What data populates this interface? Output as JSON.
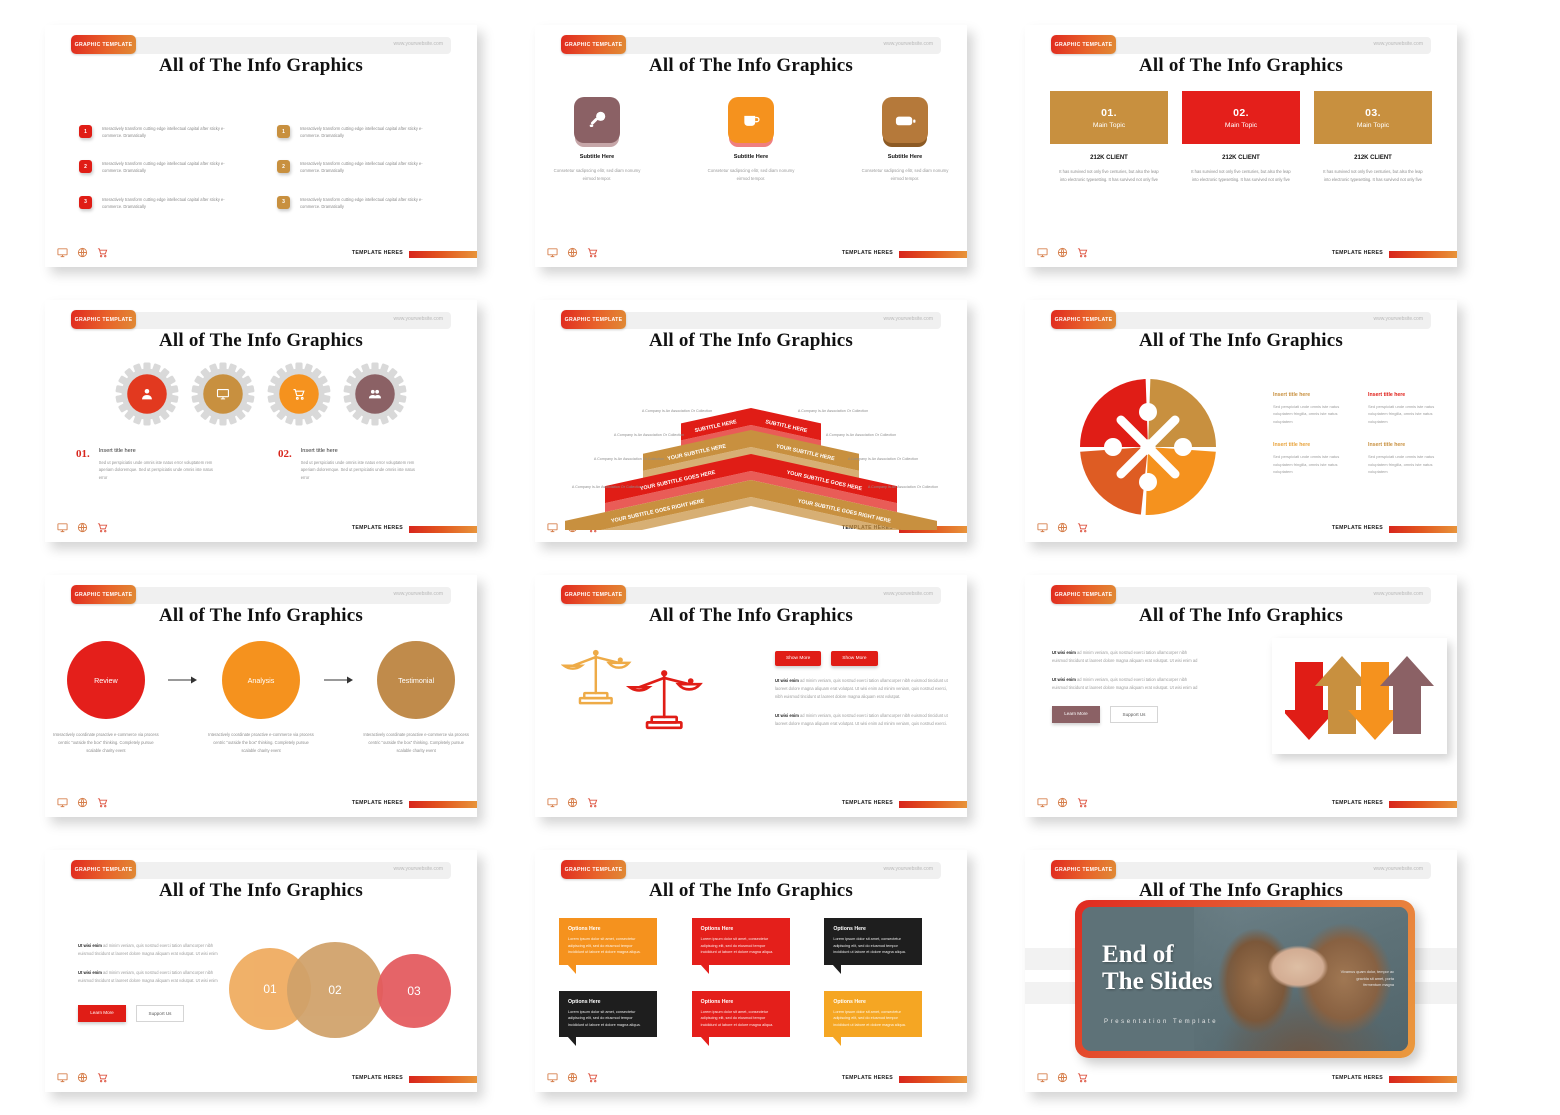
{
  "common": {
    "badge": "GRAPHIC TEMPLATE",
    "website": "www.yourwebsite.com",
    "title": "All of The Info Graphics",
    "footer_label": "TEMPLATE HERES"
  },
  "colors": {
    "red": "#e01d16",
    "orange": "#f5921e",
    "tan": "#c8903f",
    "mauve": "#8b6165",
    "brown": "#b5793a",
    "dark": "#1e1e1e",
    "peach": "#efab5e",
    "pink": "#e4595d",
    "camel": "#d0a169"
  },
  "slides": [
    {
      "id": "slide-list",
      "items_left": [
        {
          "num": "1",
          "text": "Interactively transform cutting edge intellectual capital after sticky e-commerce. Dramatically"
        },
        {
          "num": "2",
          "text": "Interactively transform cutting edge intellectual capital after sticky e-commerce. Dramatically"
        },
        {
          "num": "3",
          "text": "Interactively transform cutting edge intellectual capital after sticky e-commerce. Dramatically"
        }
      ],
      "items_right": [
        {
          "num": "1",
          "text": "Interactively transform cutting edge intellectual capital after sticky e-commerce. Dramatically"
        },
        {
          "num": "2",
          "text": "Interactively transform cutting edge intellectual capital after sticky e-commerce. Dramatically"
        },
        {
          "num": "3",
          "text": "Interactively transform cutting edge intellectual capital after sticky e-commerce. Dramatically"
        }
      ]
    },
    {
      "id": "slide-icon-cards",
      "cards": [
        {
          "icon": "key-icon",
          "color": "#8b6165",
          "shadow": "#c6a6a8",
          "subtitle": "Subtitle Here",
          "body": "Consetetur sadipscing elitr, sed diam nonumy eirmod tempor."
        },
        {
          "icon": "coffee-cup-icon",
          "color": "#f5921e",
          "shadow": "#ef7f7f",
          "subtitle": "Subtitle Here",
          "body": "Consetetur sadipscing elitr, sed diam nonumy eirmod tempor."
        },
        {
          "icon": "battery-icon",
          "color": "#b5793a",
          "shadow": "#8c5a24",
          "subtitle": "Subtitle Here",
          "body": "Consetetur sadipscing elitr, sed diam nonumy eirmod tempor."
        }
      ]
    },
    {
      "id": "slide-main-topics",
      "topics": [
        {
          "num": "01.",
          "label": "Main Topic",
          "color": "#c8903f",
          "client": "212K CLIENT",
          "body": "It has survived not only five centuries, but also the leap into electronic typesetting. It has survived not only five"
        },
        {
          "num": "02.",
          "label": "Main Topic",
          "color": "#e41f1b",
          "client": "212K CLIENT",
          "body": "It has survived not only five centuries, but also the leap into electronic typesetting. It has survived not only five"
        },
        {
          "num": "03.",
          "label": "Main Topic",
          "color": "#c8903f",
          "client": "212K CLIENT",
          "body": "It has survived not only five centuries, but also the leap into electronic typesetting. It has survived not only five"
        }
      ]
    },
    {
      "id": "slide-gears",
      "gears": [
        {
          "icon": "user-icon",
          "color": "#e2391f"
        },
        {
          "icon": "monitor-icon",
          "color": "#c8903f"
        },
        {
          "icon": "cart-icon",
          "color": "#f5921e"
        },
        {
          "icon": "group-icon",
          "color": "#8b6165"
        }
      ],
      "items": [
        {
          "num": "01.",
          "heading": "Insert title here",
          "body": "Sed ut perspiciatis unde omnis iste natus error voluptatem rem aperiam doloremque. Sed ut perspiciatis unde omnis iste natus error"
        },
        {
          "num": "02.",
          "heading": "Insert title here",
          "body": "Sed ut perspiciatis unde omnis iste natus error voluptatem rem aperiam doloremque. Sed ut perspiciatis unde omnis iste natus error"
        }
      ]
    },
    {
      "id": "slide-pyramid",
      "bands": [
        {
          "text": "SUBTITLE HERE",
          "color": "#e01d16"
        },
        {
          "text": "SUBTITLE HERE",
          "color": "#e01d16"
        },
        {
          "text": "YOUR SUBTITLE HERE",
          "color": "#c8903f"
        },
        {
          "text": "YOUR SUBTITLE HERE",
          "color": "#c8903f"
        },
        {
          "text": "YOUR SUBTITLE GOES HERE",
          "color": "#e01d16"
        },
        {
          "text": "YOUR SUBTITLE GOES HERE",
          "color": "#e01d16"
        },
        {
          "text": "YOUR SUBTITLE GOES RIGHT HERE",
          "color": "#c8903f"
        },
        {
          "text": "YOUR SUBTITLE GOES RIGHT HERE",
          "color": "#c8903f"
        }
      ],
      "side_labels": [
        "A Company Is An Association Or Collection",
        "A Company Is An Association Or Collection",
        "A Company Is An Association Or Collection",
        "A Company Is An Association Or Collection",
        "A Company Is An Association Or Collection",
        "A Company Is An Association Or Collection",
        "A Company Is An Association Or Collection",
        "A Company Is An Association Or Collection"
      ]
    },
    {
      "id": "slide-puzzle",
      "pieces": [
        "#e01d16",
        "#c8903f",
        "#f5921e",
        "#de5c23"
      ],
      "items": [
        {
          "heading": "Insert title here",
          "color": "#c8903f",
          "body": "Sed perspiciati unde omnis iste natus voluptatem fringilla, omnis iste natus voluptatem"
        },
        {
          "heading": "Insert title here",
          "color": "#e01d16",
          "body": "Sed perspiciati unde omnis iste natus voluptatem fringilla, omnis iste natus voluptatem"
        },
        {
          "heading": "Insert title here",
          "color": "#e8a33c",
          "body": "Sed perspiciati unde omnis iste natus voluptatem fringilla, omnis iste natus voluptatem"
        },
        {
          "heading": "Insert title here",
          "color": "#c8903f",
          "body": "Sed perspiciati unde omnis iste natus voluptatem fringilla, omnis iste natus voluptatem"
        }
      ]
    },
    {
      "id": "slide-process",
      "steps": [
        {
          "label": "Review",
          "color": "#e41f1b",
          "body": "Interactively coordinate proactive e-commerce via process centric \"outside the box\" thinking. Completely pursue scalable charity event"
        },
        {
          "label": "Analysis",
          "color": "#f5921e",
          "body": "Interactively coordinate proactive e-commerce via process centric \"outside the box\" thinking. Completely pursue scalable charity event"
        },
        {
          "label": "Testimonial",
          "color": "#c08b4b",
          "body": "Interactively coordinate proactive e-commerce via process centric \"outside the box\" thinking. Completely pursue scalable charity event"
        }
      ]
    },
    {
      "id": "slide-scales",
      "buttons": [
        "Show More",
        "Show More"
      ],
      "paragraphs": [
        {
          "lead": "Ut wisi enim",
          "rest": " ad minim veniam, quis nostrud exerci tation ullamcorper nibh euismod tincidunt ut laoreet dolore magna aliquam erat volutpat. Ut wisi enim ad minim veniam, quis nostrud exerci, nibh euismod tincidunt ut laoreet dolore magna aliquam erat volutpat."
        },
        {
          "lead": "Ut wisi enim",
          "rest": " ad minim veniam, quis nostrud exerci tation ullamcorper nibh euismod tincidunt ut laoreet dolore magna aliquam erat volutpat. Ut wisi enim ad minim veniam, quis nostrud exerci."
        }
      ]
    },
    {
      "id": "slide-arrows",
      "paragraphs": [
        {
          "lead": "Ut wisi enim",
          "rest": " ad minim veniam, quis nostrud exerci tation ullamcorper nibh euismod tincidunt ut laoreet dolore magna aliquam erat volutpat. Ut wisi enim ad"
        },
        {
          "lead": "Ut wisi enim",
          "rest": " ad minim veniam, quis nostrud exerci tation ullamcorper nibh euismod tincidunt ut laoreet dolore magna aliquam erat volutpat. Ut wisi enim ad"
        }
      ],
      "buttons": [
        "Learn More",
        "Support Us"
      ],
      "arrows": [
        {
          "dir": "down",
          "color": "#e01d16"
        },
        {
          "dir": "up",
          "color": "#c8903f"
        },
        {
          "dir": "down",
          "color": "#f5921e"
        },
        {
          "dir": "up",
          "color": "#8b6165"
        }
      ]
    },
    {
      "id": "slide-circles",
      "paragraphs": [
        {
          "lead": "Ut wisi enim",
          "rest": " ad minim veniam, quis nostrud exerci tation ullamcorper nibh euismod tincidunt ut laoreet dolore magna aliquam erat volutpat. Ut wisi enim"
        },
        {
          "lead": "Ut wisi enim",
          "rest": " ad minim veniam, quis nostrud exerci tation ullamcorper nibh euismod tincidunt ut laoreet dolore magna aliquam erat volutpat. Ut wisi enim"
        }
      ],
      "buttons": [
        "Learn More",
        "Support Us"
      ],
      "circles": [
        {
          "num": "01",
          "color": "#efab5e"
        },
        {
          "num": "02",
          "color": "#d0a169"
        },
        {
          "num": "03",
          "color": "#e4595d"
        }
      ]
    },
    {
      "id": "slide-bubbles",
      "bubbles": [
        {
          "heading": "Options Here",
          "color": "#f5921e",
          "body": "Lorem ipsum dolor sit amet, consectetur adipiscing elit, sed do eiusmod tempor incididunt ut labore et dolore magna aliqua."
        },
        {
          "heading": "Options Here",
          "color": "#e41f1b",
          "body": "Lorem ipsum dolor sit amet, consectetur adipiscing elit, sed do eiusmod tempor incididunt ut labore et dolore magna aliqua."
        },
        {
          "heading": "Options Here",
          "color": "#1e1e1e",
          "body": "Lorem ipsum dolor sit amet, consectetur adipiscing elit, sed do eiusmod tempor incididunt ut labore et dolore magna aliqua."
        },
        {
          "heading": "Options Here",
          "color": "#1e1e1e",
          "body": "Lorem ipsum dolor sit amet, consectetur adipiscing elit, sed do eiusmod tempor incididunt ut labore et dolore magna aliqua."
        },
        {
          "heading": "Options Here",
          "color": "#e41f1b",
          "body": "Lorem ipsum dolor sit amet, consectetur adipiscing elit, sed do eiusmod tempor incididunt ut labore et dolore magna aliqua."
        },
        {
          "heading": "Options Here",
          "color": "#f5a623",
          "body": "Lorem ipsum dolor sit amet, consectetur adipiscing elit, sed do eiusmod tempor incididunt ut labore et dolore magna aliqua."
        }
      ]
    },
    {
      "id": "slide-end",
      "title_line1": "End of",
      "title_line2": "The Slides",
      "subtitle": "Presentation Template",
      "body": "Vivamus quam dolor, tempor ac gravida sit amet, porta fermentum magna"
    }
  ]
}
